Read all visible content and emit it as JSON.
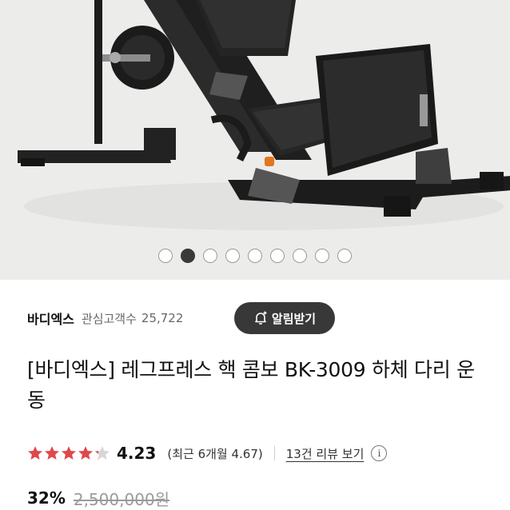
{
  "carousel": {
    "total": 9,
    "active_index": 1
  },
  "seller": {
    "brand": "바디엑스",
    "followers_label": "관심고객수",
    "followers_count": "25,722",
    "alert_button_label": "알림받기",
    "alert_button_icon": "bell-plus-icon"
  },
  "product": {
    "title": "[바디엑스] 레그프레스 핵 콤보 BK-3009 하체 다리 운동"
  },
  "rating": {
    "stars": 4.23,
    "max_stars": 5,
    "score": "4.23",
    "recent_text": "(최근 6개월 4.67)",
    "reviews_text": "13건 리뷰 보기",
    "info_icon": "info-icon",
    "star_color": "#e0474c"
  },
  "price": {
    "discount": "32%",
    "original": "2,500,000원"
  }
}
